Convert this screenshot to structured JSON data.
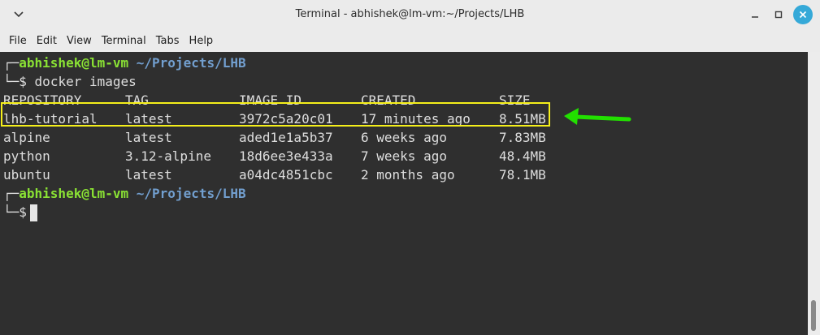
{
  "window": {
    "title": "Terminal - abhishek@lm-vm:~/Projects/LHB",
    "collapse_icon": "chevron-down-icon",
    "minimize_icon": "minimize-icon",
    "maximize_icon": "maximize-icon",
    "close_icon": "close-icon"
  },
  "menu": [
    "File",
    "Edit",
    "View",
    "Terminal",
    "Tabs",
    "Help"
  ],
  "terminal": {
    "prompt1": {
      "corner": "┌─",
      "user": "abhishek@lm-vm",
      "path": "~/Projects/LHB"
    },
    "command1": {
      "corner": "└─",
      "symbol": "$",
      "text": "docker images"
    },
    "headers": [
      "REPOSITORY",
      "TAG",
      "IMAGE ID",
      "CREATED",
      "SIZE"
    ],
    "rows": [
      [
        "lhb-tutorial",
        "latest",
        "3972c5a20c01",
        "17 minutes ago",
        "8.51MB"
      ],
      [
        "alpine",
        "latest",
        "aded1e1a5b37",
        "6 weeks ago",
        "7.83MB"
      ],
      [
        "python",
        "3.12-alpine",
        "18d6ee3e433a",
        "7 weeks ago",
        "48.4MB"
      ],
      [
        "ubuntu",
        "latest",
        "a04dc4851cbc",
        "2 months ago",
        "78.1MB"
      ]
    ],
    "prompt2": {
      "corner": "┌─",
      "user": "abhishek@lm-vm",
      "path": "~/Projects/LHB"
    },
    "command2": {
      "corner": "└─",
      "symbol": "$"
    }
  },
  "annotation": {
    "highlight_color": "#f5ef1a",
    "arrow_color": "#22e000"
  },
  "colors": {
    "terminal_bg": "#2f2f2f",
    "user": "#8ae234",
    "path": "#729fcf",
    "close_button": "#35a9d8"
  }
}
